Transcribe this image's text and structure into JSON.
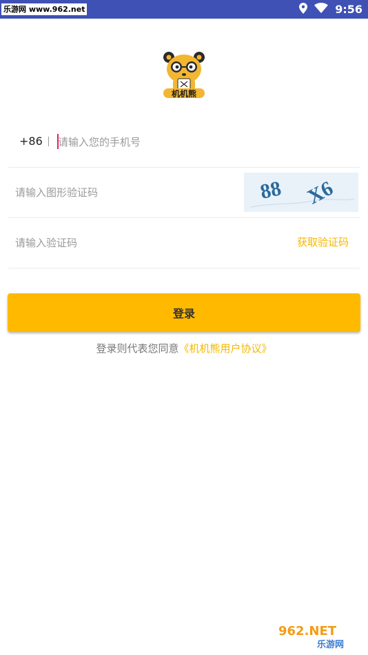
{
  "status_bar": {
    "watermark": "乐游网 www.962.net",
    "time": "9:56",
    "background": "#3f51b5"
  },
  "logo": {
    "text": "机机熊"
  },
  "phone": {
    "country_code": "+86",
    "placeholder": "请输入您的手机号",
    "value": ""
  },
  "captcha": {
    "placeholder": "请输入图形验证码",
    "value": "",
    "image_text_left": "88",
    "image_text_right": "X6"
  },
  "sms_code": {
    "placeholder": "请输入验证码",
    "value": "",
    "get_code_label": "获取验证码"
  },
  "login_button": {
    "label": "登录",
    "color": "#ffba00"
  },
  "agreement": {
    "prefix": "登录则代表您同意",
    "link": "《机机熊用户协议》",
    "link_color": "#f5b800"
  },
  "watermark_corner": {
    "top": "962.NET",
    "bottom": "乐游网"
  }
}
